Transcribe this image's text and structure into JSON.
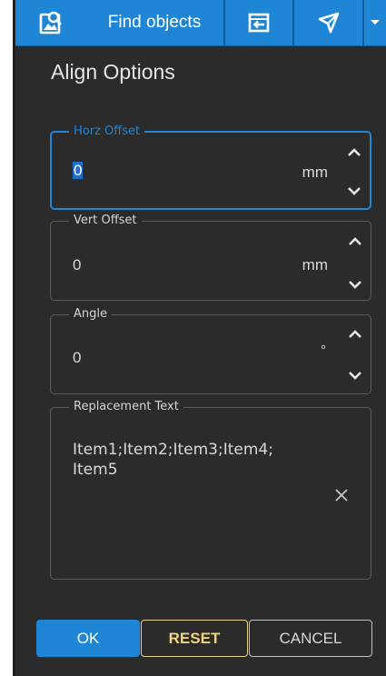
{
  "toolbar": {
    "find_objects_label": "Find objects",
    "icons": [
      "find-objects-icon",
      "import-icon",
      "send-icon",
      "dropdown-icon"
    ],
    "background_color": "#1f86d6"
  },
  "dialog": {
    "title": "Align Options"
  },
  "fields": {
    "horz_offset": {
      "label": "Horz Offset",
      "value": "0",
      "unit": "mm",
      "focused": true
    },
    "vert_offset": {
      "label": "Vert Offset",
      "value": "0",
      "unit": "mm"
    },
    "angle": {
      "label": "Angle",
      "value": "0",
      "unit": "°"
    },
    "replacement_text": {
      "label": "Replacement Text",
      "value": "Item1;Item2;Item3;Item4;\nItem5"
    }
  },
  "buttons": {
    "ok": "OK",
    "reset": "RESET",
    "cancel": "CANCEL"
  },
  "colors": {
    "accent": "#1f86d6",
    "reset_text": "#f2d27a",
    "panel_background": "#2b2b2b"
  }
}
